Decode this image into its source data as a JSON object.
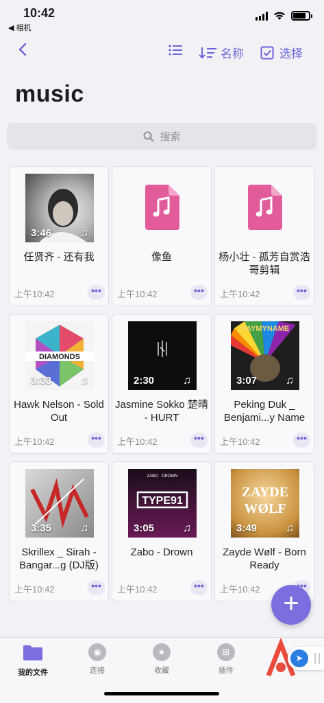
{
  "status": {
    "time": "10:42",
    "back_app": "◀ 相机"
  },
  "nav": {
    "sort_label": "名称",
    "select_label": "选择"
  },
  "page": {
    "title": "music"
  },
  "search": {
    "placeholder": "搜索"
  },
  "files": [
    {
      "name": "任贤齐 - 还有我",
      "date": "上午10:42",
      "duration": "3:46",
      "kind": "album",
      "art": "rxq"
    },
    {
      "name": "像鱼",
      "date": "上午10:42",
      "duration": "",
      "kind": "file"
    },
    {
      "name": "杨小壮 - 孤芳自赏浩哥剪辑",
      "date": "上午10:42",
      "duration": "",
      "kind": "file"
    },
    {
      "name": "Hawk Nelson - Sold Out",
      "date": "上午10:42",
      "duration": "3:33",
      "kind": "album",
      "art": "diamonds",
      "art_text": "DIAMONDS"
    },
    {
      "name": "Jasmine Sokko 楚晴 - HURT",
      "date": "上午10:42",
      "duration": "2:30",
      "kind": "album",
      "art": "hurt"
    },
    {
      "name": "Peking Duk _ Benjami...y Name",
      "date": "上午10:42",
      "duration": "3:07",
      "kind": "album",
      "art": "saymyname",
      "art_text": "SAYMYNAME"
    },
    {
      "name": "Skrillex _ Sirah - Bangar...g (DJ版)",
      "date": "上午10:42",
      "duration": "3:35",
      "kind": "album",
      "art": "skrillex"
    },
    {
      "name": "Zabo - Drown",
      "date": "上午10:42",
      "duration": "3:05",
      "kind": "album",
      "art": "type91",
      "art_text": "TYPE91",
      "art_top": "ZABO · DROWN"
    },
    {
      "name": "Zayde Wølf - Born Ready",
      "date": "上午10:42",
      "duration": "3:49",
      "kind": "album",
      "art": "zayde",
      "art_text": "ZAYDE",
      "art_text2": "WØLF"
    }
  ],
  "more_label": "•••",
  "tabs": [
    {
      "label": "我的文件",
      "active": true
    },
    {
      "label": "连接"
    },
    {
      "label": "收藏"
    },
    {
      "label": "插件"
    }
  ],
  "colors": {
    "accent": "#6c63d9",
    "file_icon": "#e25c9c",
    "fab": "#7b6fe0"
  }
}
